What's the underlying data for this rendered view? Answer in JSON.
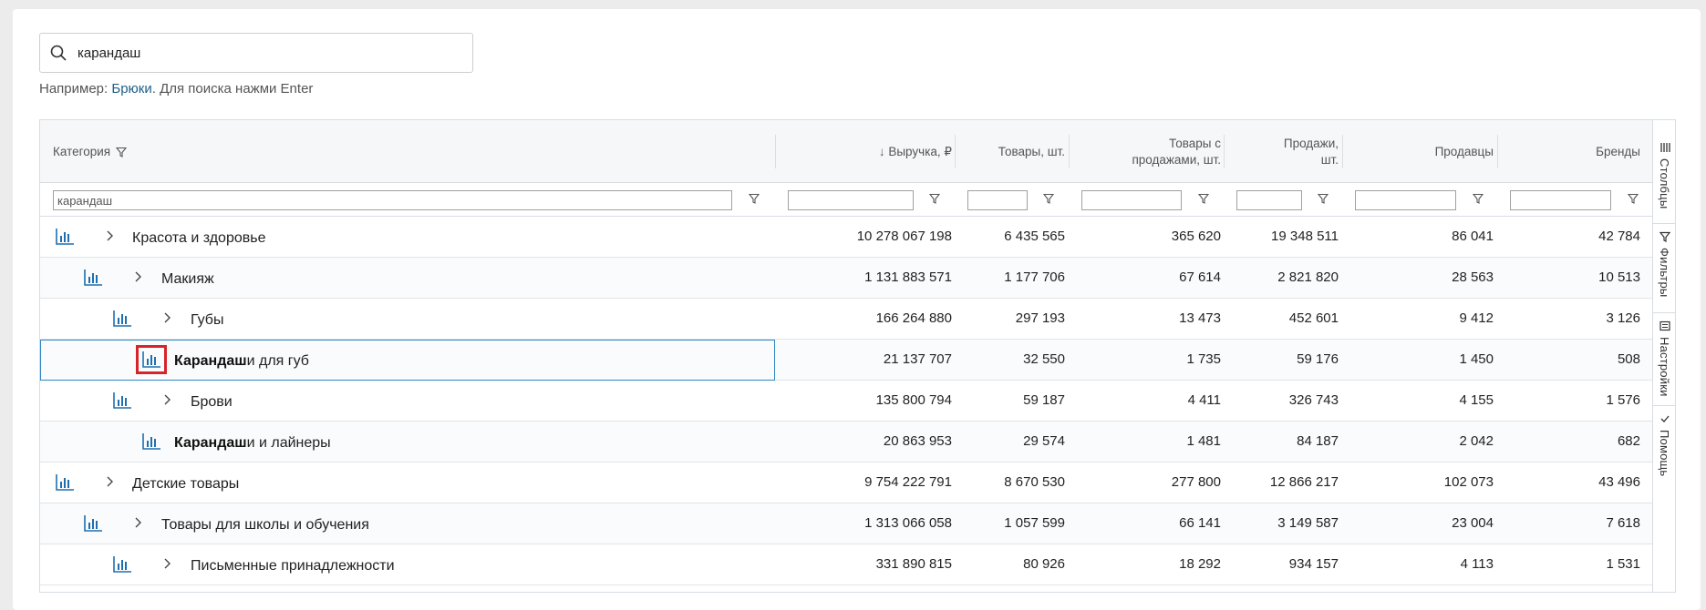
{
  "search": {
    "value": "карандаш",
    "placeholder": ""
  },
  "hint": {
    "prefix": "Например: ",
    "example": "Брюки",
    "suffix": ". Для поиска нажми Enter"
  },
  "columns": {
    "category": "Категория",
    "revenue": "↓ Выручка, ₽",
    "goods": "Товары, шт.",
    "goods_with_sales_1": "Товары с",
    "goods_with_sales_2": "продажами, шт.",
    "sales_1": "Продажи,",
    "sales_2": "шт.",
    "sellers": "Продавцы",
    "brands": "Бренды"
  },
  "filters": {
    "category": "карандаш"
  },
  "rows": [
    {
      "pre": "Красота и здоровье",
      "bold": "",
      "post": "",
      "revenue": "10 278 067 198",
      "goods": "6 435 565",
      "goods_with_sales": "365 620",
      "sales": "19 348 511",
      "sellers": "86 041",
      "brands": "42 784"
    },
    {
      "pre": "Макияж",
      "bold": "",
      "post": "",
      "revenue": "1 131 883 571",
      "goods": "1 177 706",
      "goods_with_sales": "67 614",
      "sales": "2 821 820",
      "sellers": "28 563",
      "brands": "10 513"
    },
    {
      "pre": "Губы",
      "bold": "",
      "post": "",
      "revenue": "166 264 880",
      "goods": "297 193",
      "goods_with_sales": "13 473",
      "sales": "452 601",
      "sellers": "9 412",
      "brands": "3 126"
    },
    {
      "pre": "",
      "bold": "Карандаш",
      "post": "и для губ",
      "revenue": "21 137 707",
      "goods": "32 550",
      "goods_with_sales": "1 735",
      "sales": "59 176",
      "sellers": "1 450",
      "brands": "508"
    },
    {
      "pre": "Брови",
      "bold": "",
      "post": "",
      "revenue": "135 800 794",
      "goods": "59 187",
      "goods_with_sales": "4 411",
      "sales": "326 743",
      "sellers": "4 155",
      "brands": "1 576"
    },
    {
      "pre": "",
      "bold": "Карандаш",
      "post": "и и лайнеры",
      "revenue": "20 863 953",
      "goods": "29 574",
      "goods_with_sales": "1 481",
      "sales": "84 187",
      "sellers": "2 042",
      "brands": "682"
    },
    {
      "pre": "Детские товары",
      "bold": "",
      "post": "",
      "revenue": "9 754 222 791",
      "goods": "8 670 530",
      "goods_with_sales": "277 800",
      "sales": "12 866 217",
      "sellers": "102 073",
      "brands": "43 496"
    },
    {
      "pre": "Товары для школы и обучения",
      "bold": "",
      "post": "",
      "revenue": "1 313 066 058",
      "goods": "1 057 599",
      "goods_with_sales": "66 141",
      "sales": "3 149 587",
      "sellers": "23 004",
      "brands": "7 618"
    },
    {
      "pre": "Письменные принадлежности",
      "bold": "",
      "post": "",
      "revenue": "331 890 815",
      "goods": "80 926",
      "goods_with_sales": "18 292",
      "sales": "934 157",
      "sellers": "4 113",
      "brands": "1 531"
    }
  ],
  "side_panel": {
    "columns": "Столбцы",
    "filters": "Фильтры",
    "settings": "Настройки",
    "help": "Помощь"
  },
  "colors": {
    "accent": "#1f6fb0",
    "highlight": "#d9232a",
    "selection": "#2f87c4"
  }
}
